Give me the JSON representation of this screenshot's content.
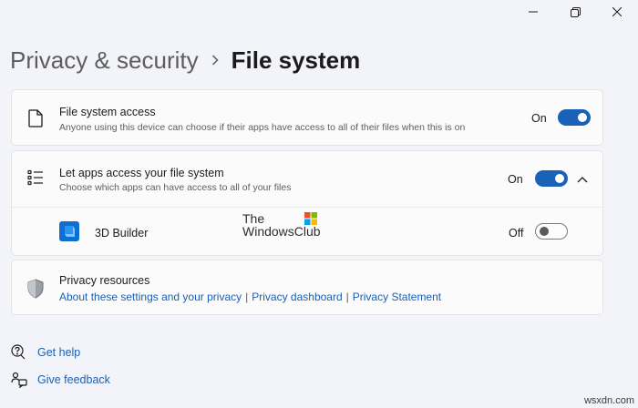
{
  "window": {
    "controls": [
      "minimize-icon",
      "restore-icon",
      "close-icon"
    ]
  },
  "breadcrumb": {
    "parent": "Privacy & security",
    "current": "File system"
  },
  "file_system_access": {
    "icon": "document-icon",
    "title": "File system access",
    "description": "Anyone using this device can choose if their apps have access to all of their files when this is on",
    "state": "On",
    "enabled": true
  },
  "let_apps": {
    "icon": "list-icon",
    "title": "Let apps access your file system",
    "description": "Choose which apps can have access to all of your files",
    "state": "On",
    "enabled": true,
    "expanded": true,
    "apps": [
      {
        "name": "3D Builder",
        "icon": "3d-builder-app-icon",
        "state": "Off",
        "enabled": false
      }
    ]
  },
  "privacy_resources": {
    "icon": "shield-icon",
    "title": "Privacy resources",
    "links": [
      "About these settings and your privacy",
      "Privacy dashboard",
      "Privacy Statement"
    ],
    "separator": "|"
  },
  "footer": [
    {
      "label": "Get help",
      "icon": "help-icon"
    },
    {
      "label": "Give feedback",
      "icon": "feedback-icon"
    }
  ],
  "watermark": {
    "line1": "The",
    "line2": "WindowsClub"
  },
  "site_mark": "wsxdn.com",
  "colors": {
    "accent": "#1a62b8",
    "link": "#1a5fb4",
    "background": "#f3f4f9",
    "card": "#fbfbfb"
  }
}
